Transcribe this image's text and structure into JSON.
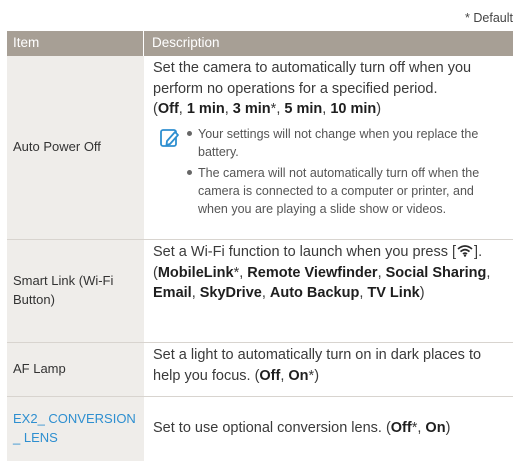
{
  "default_note": "* Default",
  "header": {
    "item": "Item",
    "description": "Description"
  },
  "rows": [
    {
      "item": "Auto Power Off",
      "desc_text": "Set the camera to automatically turn off when you perform no operations for a specified period.",
      "options": [
        "Off",
        "1 min",
        "3 min",
        "5 min",
        "10 min"
      ],
      "default_marker": "*",
      "notes": [
        "Your settings will not change when you replace the battery.",
        "The camera will not automatically turn off when the camera is connected to a computer or printer, and when you are playing a slide show or videos."
      ]
    },
    {
      "item": "Smart Link (Wi-Fi Button)",
      "desc_text": "Set a Wi-Fi function to launch when you press",
      "options": [
        "MobileLink",
        "Remote Viewfinder",
        "Social Sharing",
        "Email",
        "SkyDrive",
        "Auto Backup",
        "TV Link"
      ]
    },
    {
      "item": "AF Lamp",
      "desc_text": "Set a light to automatically turn on in dark places to help you focus.",
      "options": [
        "Off",
        "On"
      ]
    },
    {
      "item": "EX2_ CONVERSION_ LENS",
      "desc_text": "Set to use optional conversion lens.",
      "options": [
        "Off",
        "On"
      ]
    }
  ]
}
